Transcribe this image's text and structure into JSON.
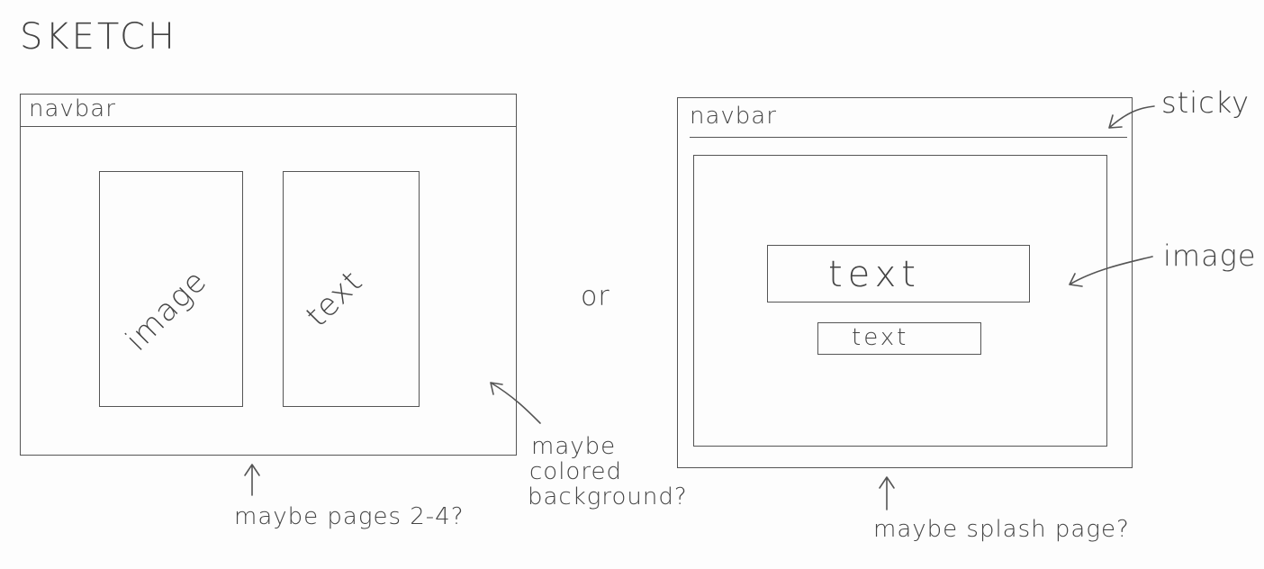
{
  "title": "SKETCH",
  "left_sketch": {
    "navbar": "navbar",
    "image_box": "image",
    "text_box": "text",
    "note_bottom": "maybe pages 2-4?",
    "note_right": [
      "maybe",
      "colored",
      "background?"
    ]
  },
  "separator": "or",
  "right_sketch": {
    "navbar": "navbar",
    "text_large": "text",
    "text_small": "text",
    "label_sticky": "sticky",
    "label_image": "image",
    "note_bottom": "maybe splash page?"
  }
}
